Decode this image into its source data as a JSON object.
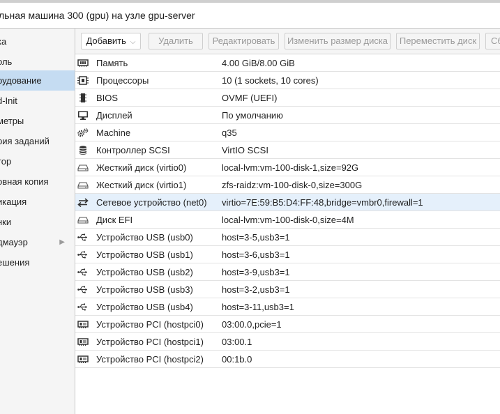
{
  "window": {
    "title": "льная машина 300 (gpu) на узле gpu-server"
  },
  "sidebar": {
    "items": [
      {
        "label": "ка",
        "selected": false,
        "has_arrow": false,
        "icon": "none"
      },
      {
        "label": "оль",
        "selected": false,
        "has_arrow": false,
        "icon": "none"
      },
      {
        "label": "рудование",
        "selected": true,
        "has_arrow": false,
        "icon": "none"
      },
      {
        "label": "d-Init",
        "selected": false,
        "has_arrow": false,
        "icon": "none"
      },
      {
        "label": "метры",
        "selected": false,
        "has_arrow": false,
        "icon": "none"
      },
      {
        "label": "рия заданий",
        "selected": false,
        "has_arrow": false,
        "icon": "none"
      },
      {
        "label": "тор",
        "selected": false,
        "has_arrow": false,
        "icon": "none"
      },
      {
        "label": "овная копия",
        "selected": false,
        "has_arrow": false,
        "icon": "none"
      },
      {
        "label": "икация",
        "selected": false,
        "has_arrow": false,
        "icon": "none"
      },
      {
        "label": "нки",
        "selected": false,
        "has_arrow": false,
        "icon": "none"
      },
      {
        "label": "дмауэр",
        "selected": false,
        "has_arrow": true,
        "icon": "chevron-right-icon"
      },
      {
        "label": "ешения",
        "selected": false,
        "has_arrow": false,
        "icon": "none"
      }
    ]
  },
  "toolbar": {
    "add_label": "Добавить",
    "remove_label": "Удалить",
    "edit_label": "Редактировать",
    "resize_label": "Изменить размер диска",
    "move_label": "Переместить диск",
    "partial_label": "Сб"
  },
  "hardware": {
    "rows": [
      {
        "icon": "memory-icon",
        "name": "Память",
        "value": "4.00 GiB/8.00 GiB"
      },
      {
        "icon": "cpu-icon",
        "name": "Процессоры",
        "value": "10 (1 sockets, 10 cores)"
      },
      {
        "icon": "bios-chip-icon",
        "name": "BIOS",
        "value": "OVMF (UEFI)"
      },
      {
        "icon": "monitor-icon",
        "name": "Дисплей",
        "value": "По умолчанию"
      },
      {
        "icon": "cogs-icon",
        "name": "Machine",
        "value": "q35"
      },
      {
        "icon": "database-icon",
        "name": "Контроллер SCSI",
        "value": "VirtIO SCSI"
      },
      {
        "icon": "hard-disk-icon",
        "name": "Жесткий диск (virtio0)",
        "value": "local-lvm:vm-100-disk-1,size=92G"
      },
      {
        "icon": "hard-disk-icon",
        "name": "Жесткий диск (virtio1)",
        "value": "zfs-raidz:vm-100-disk-0,size=300G"
      },
      {
        "icon": "network-exchange-icon",
        "name": "Сетевое устройство (net0)",
        "value": "virtio=7E:59:B5:D4:FF:48,bridge=vmbr0,firewall=1",
        "selected": true
      },
      {
        "icon": "hard-disk-icon",
        "name": "Диск EFI",
        "value": "local-lvm:vm-100-disk-0,size=4M"
      },
      {
        "icon": "usb-icon",
        "name": "Устройство USB (usb0)",
        "value": "host=3-5,usb3=1"
      },
      {
        "icon": "usb-icon",
        "name": "Устройство USB (usb1)",
        "value": "host=3-6,usb3=1"
      },
      {
        "icon": "usb-icon",
        "name": "Устройство USB (usb2)",
        "value": "host=3-9,usb3=1"
      },
      {
        "icon": "usb-icon",
        "name": "Устройство USB (usb3)",
        "value": "host=3-2,usb3=1"
      },
      {
        "icon": "usb-icon",
        "name": "Устройство USB (usb4)",
        "value": "host=3-11,usb3=1"
      },
      {
        "icon": "pci-card-icon",
        "name": "Устройство PCI (hostpci0)",
        "value": "03:00.0,pcie=1"
      },
      {
        "icon": "pci-card-icon",
        "name": "Устройство PCI (hostpci1)",
        "value": "03:00.1"
      },
      {
        "icon": "pci-card-icon",
        "name": "Устройство PCI (hostpci2)",
        "value": "00:1b.0"
      }
    ]
  },
  "colors": {
    "selected_nav": "#c5dcf2",
    "selected_row": "#e5f0fb",
    "panel_bg": "#f5f5f5",
    "border": "#c9c9c9"
  }
}
